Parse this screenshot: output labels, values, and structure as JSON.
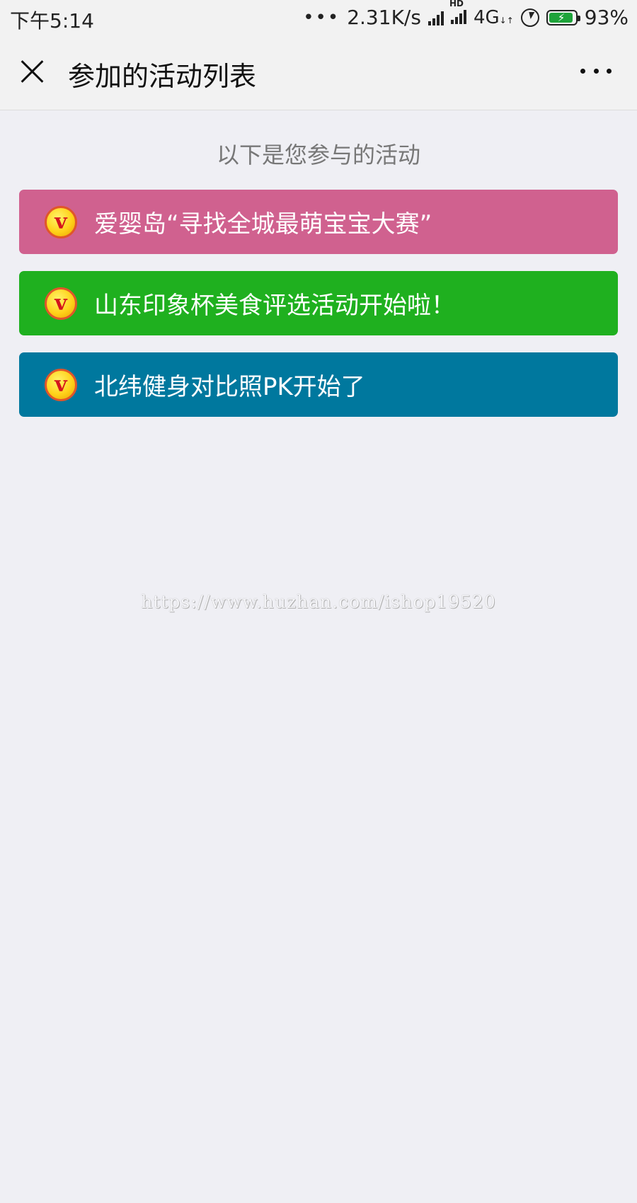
{
  "status_bar": {
    "time": "下午5:14",
    "dots": "•••",
    "speed": "2.31K/s",
    "hd": "HD",
    "network": "4G",
    "network_arrows": "↓↑",
    "battery_percent": "93%",
    "battery_level": 0.93
  },
  "nav": {
    "title": "参加的活动列表"
  },
  "subtitle": "以下是您参与的活动",
  "activities": [
    {
      "label": "爱婴岛“寻找全城最萌宝宝大赛”",
      "color": "#d0618f",
      "icon": "v-badge-icon",
      "icon_text": "v"
    },
    {
      "label": "山东印象杯美食评选活动开始啦！",
      "color": "#1fb01f",
      "icon": "v-badge-icon",
      "icon_text": "v"
    },
    {
      "label": "北纬健身对比照PK开始了",
      "color": "#00789e",
      "icon": "v-badge-icon",
      "icon_text": "v"
    }
  ],
  "watermark": "https://www.huzhan.com/ishop19520"
}
